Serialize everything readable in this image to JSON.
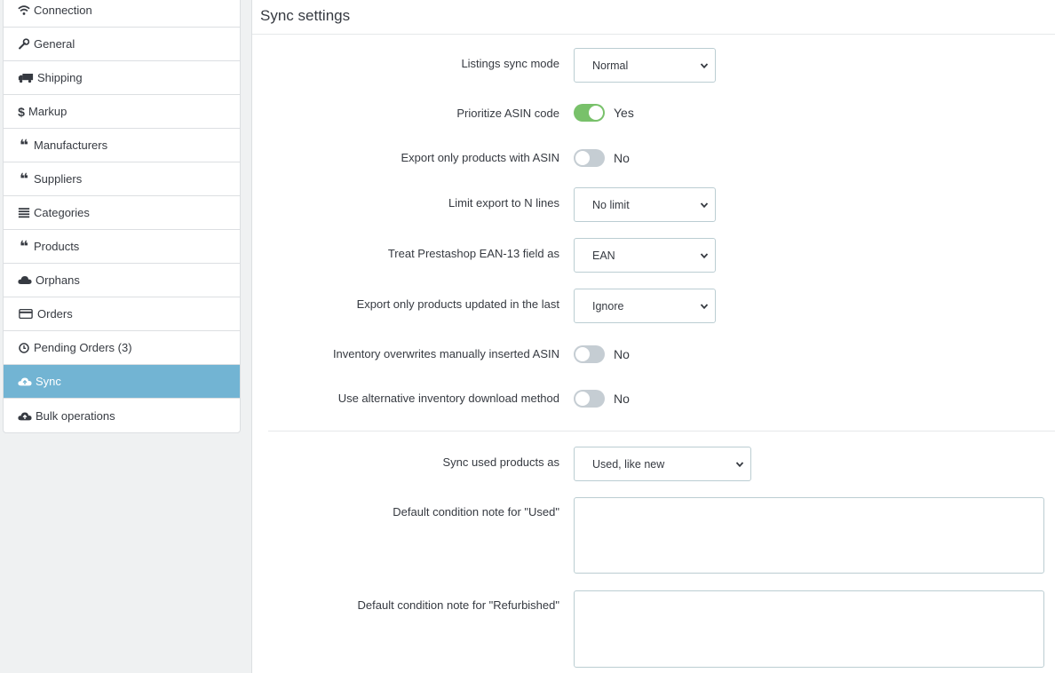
{
  "sidebar": {
    "items": [
      {
        "label": "Connection",
        "icon": "wifi-icon"
      },
      {
        "label": "General",
        "icon": "wrench-icon"
      },
      {
        "label": "Shipping",
        "icon": "truck-icon"
      },
      {
        "label": "Markup",
        "icon": "dollar-icon"
      },
      {
        "label": "Manufacturers",
        "icon": "quote-icon"
      },
      {
        "label": "Suppliers",
        "icon": "quote-icon"
      },
      {
        "label": "Categories",
        "icon": "list-icon"
      },
      {
        "label": "Products",
        "icon": "quote-icon"
      },
      {
        "label": "Orphans",
        "icon": "cloud-icon"
      },
      {
        "label": "Orders",
        "icon": "credit-card-icon"
      },
      {
        "label": "Pending Orders (3)",
        "icon": "clock-icon"
      },
      {
        "label": "Sync",
        "icon": "cloud-upload-icon"
      },
      {
        "label": "Bulk operations",
        "icon": "cloud-upload-icon"
      }
    ],
    "active_color": "#72b4d3"
  },
  "panel": {
    "title": "Sync settings",
    "fields": {
      "sync_mode": {
        "label": "Listings sync mode",
        "value": "Normal"
      },
      "prioritize_asin": {
        "label": "Prioritize ASIN code",
        "state": "Yes"
      },
      "export_only_asin": {
        "label": "Export only products with ASIN",
        "state": "No"
      },
      "limit_export": {
        "label": "Limit export to N lines",
        "value": "No limit"
      },
      "ean_field": {
        "label": "Treat Prestashop EAN-13 field as",
        "value": "EAN"
      },
      "updated_last": {
        "label": "Export only products updated in the last",
        "value": "Ignore"
      },
      "inventory_overwrite": {
        "label": "Inventory overwrites manually inserted ASIN",
        "state": "No"
      },
      "alt_inventory": {
        "label": "Use alternative inventory download method",
        "state": "No"
      },
      "used_as": {
        "label": "Sync used products as",
        "value": "Used, like new"
      },
      "note_used": {
        "label": "Default condition note for \"Used\"",
        "value": ""
      },
      "note_refurbished": {
        "label": "Default condition note for \"Refurbished\"",
        "value": ""
      }
    },
    "toggle_on_color": "#78c16a",
    "toggle_off_color": "#c5cdd3"
  }
}
